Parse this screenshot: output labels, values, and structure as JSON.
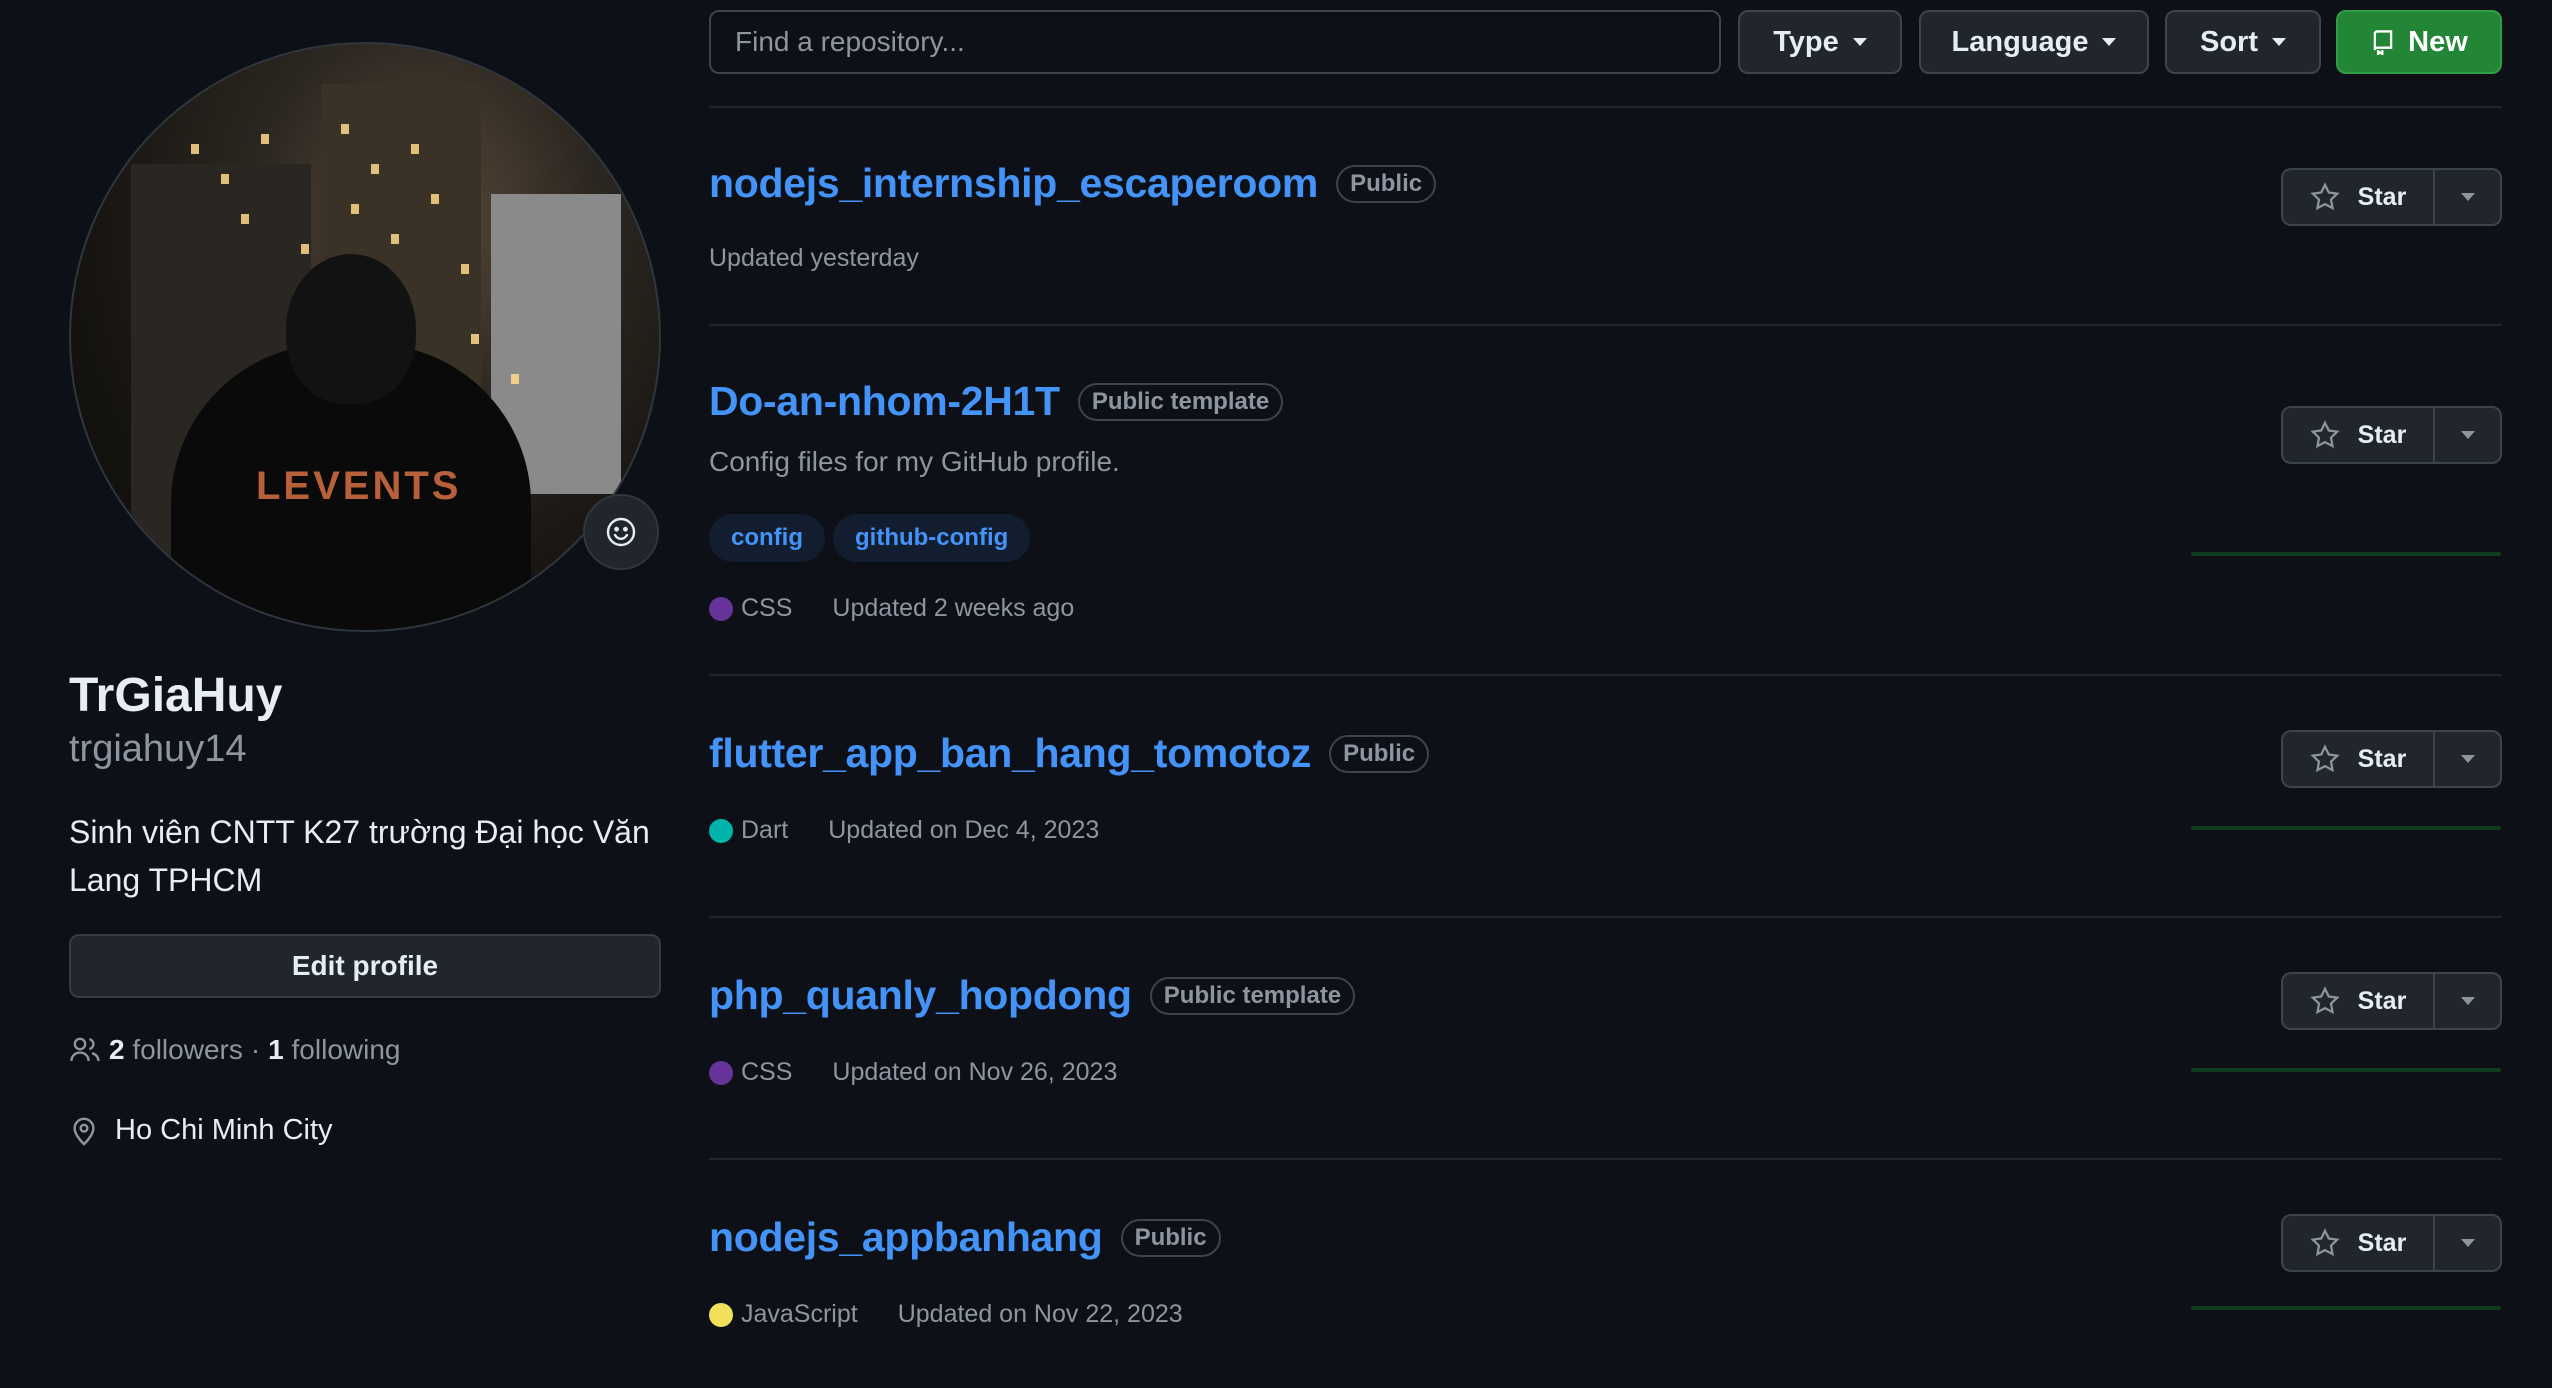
{
  "profile": {
    "full_name": "TrGiaHuy",
    "username": "trgiahuy14",
    "bio": "Sinh viên CNTT K27 trường Đại học Văn Lang TPHCM",
    "edit_label": "Edit profile",
    "followers_count": "2",
    "followers_label": "followers",
    "separator": "·",
    "following_count": "1",
    "following_label": "following",
    "location": "Ho Chi Minh City",
    "avatar_shirt_text": "LEVENTS"
  },
  "toolbar": {
    "search_placeholder": "Find a repository...",
    "type_label": "Type",
    "language_label": "Language",
    "sort_label": "Sort",
    "new_label": "New"
  },
  "colors": {
    "link": "#4493f8",
    "new_button": "#238636",
    "css": "#663399",
    "dart": "#00B4AB",
    "javascript": "#f1e05a"
  },
  "star_label": "Star",
  "repos": [
    {
      "name": "nodejs_internship_escaperoom",
      "visibility": "Public",
      "updated": "Updated yesterday"
    },
    {
      "name": "Do-an-nhom-2H1T",
      "visibility": "Public template",
      "description": "Config files for my GitHub profile.",
      "topics": [
        "config",
        "github-config"
      ],
      "language": "CSS",
      "updated": "Updated 2 weeks ago"
    },
    {
      "name": "flutter_app_ban_hang_tomotoz",
      "visibility": "Public",
      "language": "Dart",
      "updated": "Updated on Dec 4, 2023"
    },
    {
      "name": "php_quanly_hopdong",
      "visibility": "Public template",
      "language": "CSS",
      "updated": "Updated on Nov 26, 2023"
    },
    {
      "name": "nodejs_appbanhang",
      "visibility": "Public",
      "language": "JavaScript",
      "updated": "Updated on Nov 22, 2023"
    }
  ]
}
